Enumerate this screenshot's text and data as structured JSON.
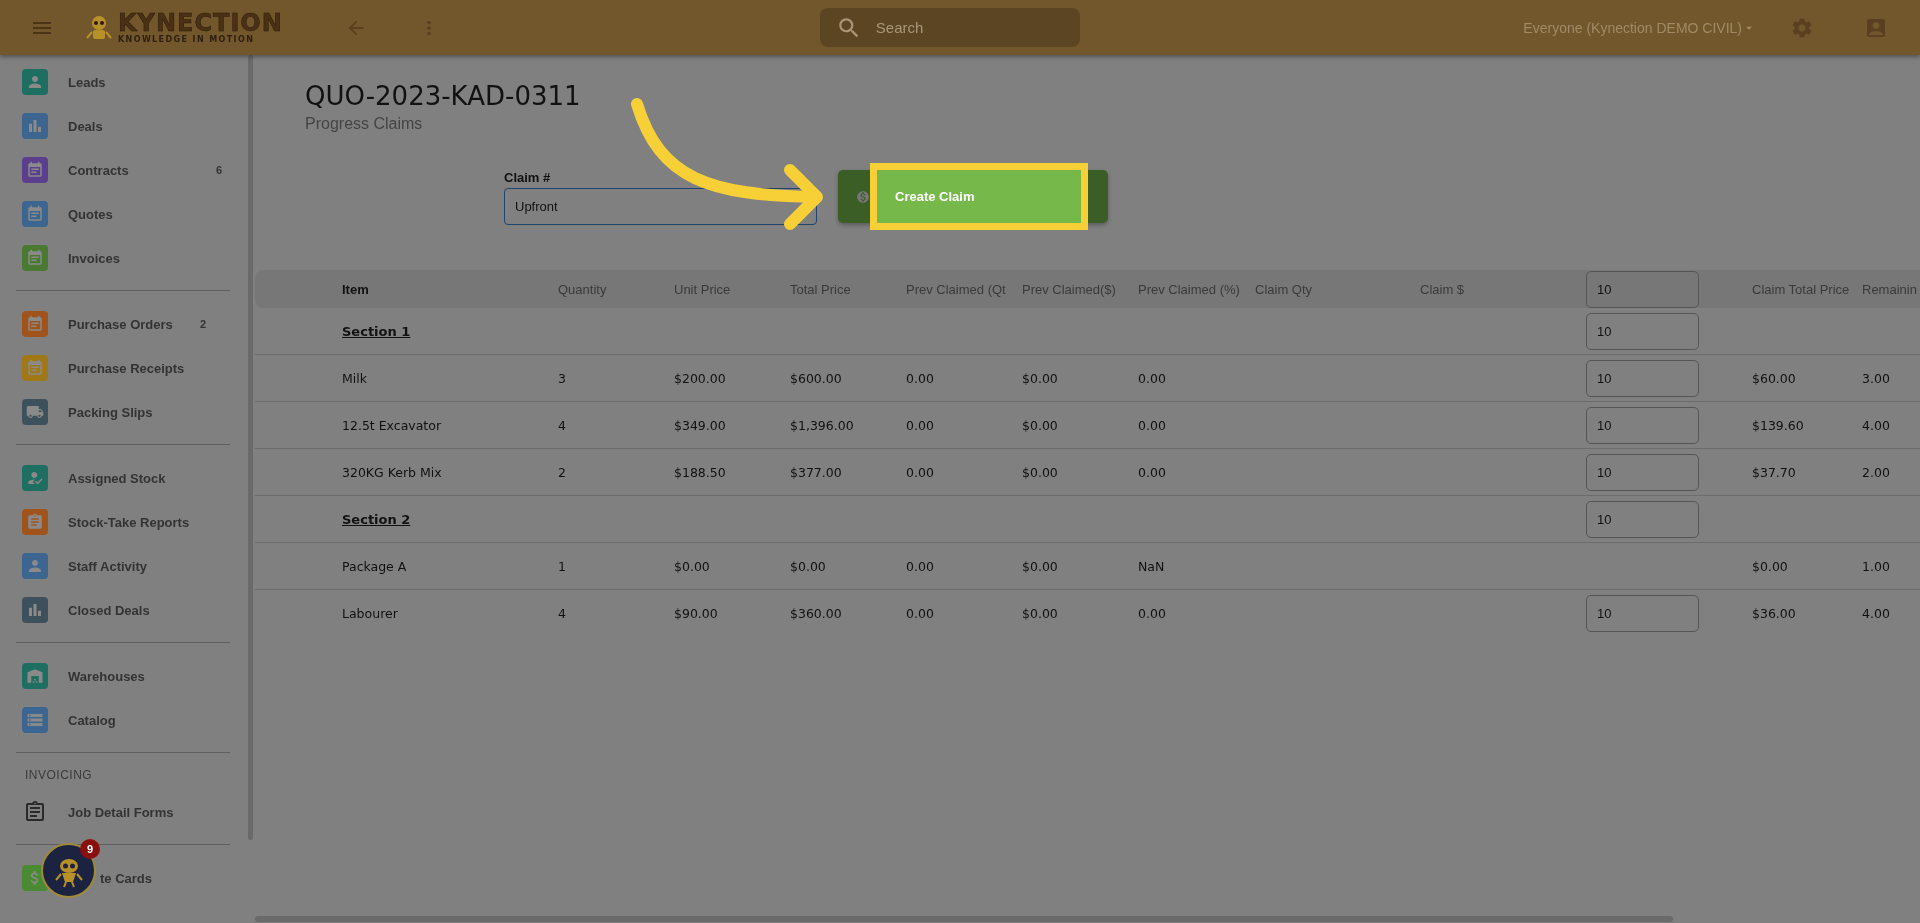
{
  "header": {
    "logo_text": "KYNECTION",
    "logo_tagline": "KNOWLEDGE IN MOTION",
    "search": {
      "placeholder": "Search"
    },
    "account_selector": "Everyone (Kynection DEMO CIVIL)"
  },
  "sidebar": {
    "groups": [
      {
        "items": [
          {
            "label": "Leads",
            "color": "#1e6e62"
          },
          {
            "label": "Deals",
            "color": "#3c6590"
          },
          {
            "label": "Contracts",
            "color": "#5b3f8c",
            "badge": "6"
          },
          {
            "label": "Quotes",
            "color": "#3c6590"
          },
          {
            "label": "Invoices",
            "color": "#4a7a32"
          }
        ]
      },
      {
        "items": [
          {
            "label": "Purchase Orders",
            "color": "#a0541c",
            "badge": "2"
          },
          {
            "label": "Purchase Receipts",
            "color": "#a07818"
          },
          {
            "label": "Packing Slips",
            "color": "#3d515c"
          }
        ]
      },
      {
        "items": [
          {
            "label": "Assigned Stock",
            "color": "#1e6e62"
          },
          {
            "label": "Stock-Take Reports",
            "color": "#a0541c"
          },
          {
            "label": "Staff Activity",
            "color": "#3c6590"
          },
          {
            "label": "Closed Deals",
            "color": "#3d515c"
          }
        ]
      },
      {
        "items": [
          {
            "label": "Warehouses",
            "color": "#1e6e62"
          },
          {
            "label": "Catalog",
            "color": "#3c6590"
          }
        ]
      },
      {
        "heading": "INVOICING",
        "items": [
          {
            "label": "Job Detail Forms"
          }
        ]
      },
      {
        "items": [
          {
            "label": "te Cards",
            "color": "#4a8a32"
          }
        ]
      }
    ]
  },
  "assistant": {
    "badge": "9"
  },
  "page": {
    "title": "QUO-2023-KAD-0311",
    "subtitle": "Progress Claims",
    "claim_field": {
      "label": "Claim #",
      "value": "Upfront"
    },
    "create_button": "Create Claim"
  },
  "table": {
    "columns": [
      {
        "kind": "text",
        "label": "Item"
      },
      {
        "kind": "text",
        "label": "Quantity"
      },
      {
        "kind": "text",
        "label": "Unit Price"
      },
      {
        "kind": "text",
        "label": "Total Price"
      },
      {
        "kind": "text",
        "label": "Prev Claimed (Qt"
      },
      {
        "kind": "text",
        "label": "Prev Claimed($)"
      },
      {
        "kind": "text",
        "label": "Prev Claimed (%)"
      },
      {
        "kind": "text",
        "label": "Claim Qty"
      },
      {
        "kind": "text",
        "label": "Claim $"
      },
      {
        "kind": "input",
        "value": "10"
      },
      {
        "kind": "text",
        "label": "Claim Total Price"
      },
      {
        "kind": "text",
        "label": "Remainin"
      }
    ],
    "rows": [
      {
        "kind": "section",
        "label": "Section 1",
        "claim_input": "10"
      },
      {
        "kind": "item",
        "item": "Milk",
        "quantity": "3",
        "unit_price": "$200.00",
        "total_price": "$600.00",
        "prev_claimed_qty": "0.00",
        "prev_claimed_amount": "$0.00",
        "prev_claimed_pct": "0.00",
        "claim_input": "10",
        "claim_total_price": "$60.00",
        "remaining": "3.00"
      },
      {
        "kind": "item",
        "item": "12.5t Excavator",
        "quantity": "4",
        "unit_price": "$349.00",
        "total_price": "$1,396.00",
        "prev_claimed_qty": "0.00",
        "prev_claimed_amount": "$0.00",
        "prev_claimed_pct": "0.00",
        "claim_input": "10",
        "claim_total_price": "$139.60",
        "remaining": "4.00"
      },
      {
        "kind": "item",
        "item": "320KG Kerb Mix",
        "quantity": "2",
        "unit_price": "$188.50",
        "total_price": "$377.00",
        "prev_claimed_qty": "0.00",
        "prev_claimed_amount": "$0.00",
        "prev_claimed_pct": "0.00",
        "claim_input": "10",
        "claim_total_price": "$37.70",
        "remaining": "2.00"
      },
      {
        "kind": "section",
        "label": "Section 2",
        "claim_input": "10"
      },
      {
        "kind": "item",
        "item": "Package A",
        "quantity": "1",
        "unit_price": "$0.00",
        "total_price": "$0.00",
        "prev_claimed_qty": "0.00",
        "prev_claimed_amount": "$0.00",
        "prev_claimed_pct": "NaN",
        "claim_total_price": "$0.00",
        "remaining": "1.00"
      },
      {
        "kind": "item",
        "item": "Labourer",
        "quantity": "4",
        "unit_price": "$90.00",
        "total_price": "$360.00",
        "prev_claimed_qty": "0.00",
        "prev_claimed_amount": "$0.00",
        "prev_claimed_pct": "0.00",
        "claim_input": "10",
        "claim_total_price": "$36.00",
        "remaining": "4.00"
      }
    ]
  }
}
